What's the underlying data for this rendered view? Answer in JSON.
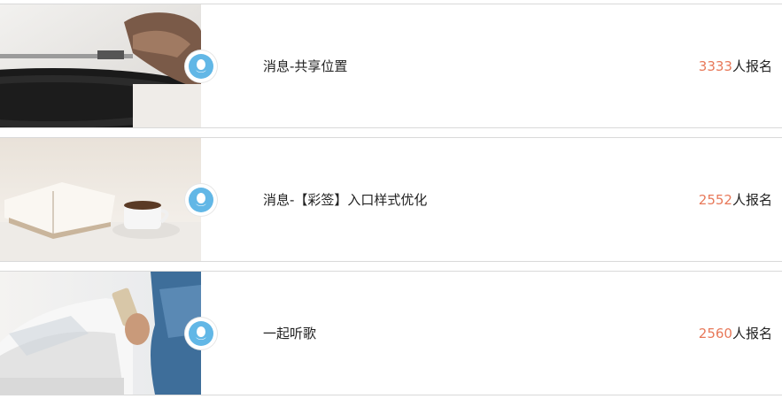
{
  "accent_color": "#62b7e6",
  "count_color": "#e8795a",
  "items": [
    {
      "title": "消息-共享位置",
      "count": "3333",
      "count_suffix": "人报名",
      "image": "record-player-photo"
    },
    {
      "title": "消息-【彩签】入口样式优化",
      "count": "2552",
      "count_suffix": "人报名",
      "image": "book-and-coffee-photo"
    },
    {
      "title": "一起听歌",
      "count": "2560",
      "count_suffix": "人报名",
      "image": "phone-in-car-photo"
    }
  ]
}
